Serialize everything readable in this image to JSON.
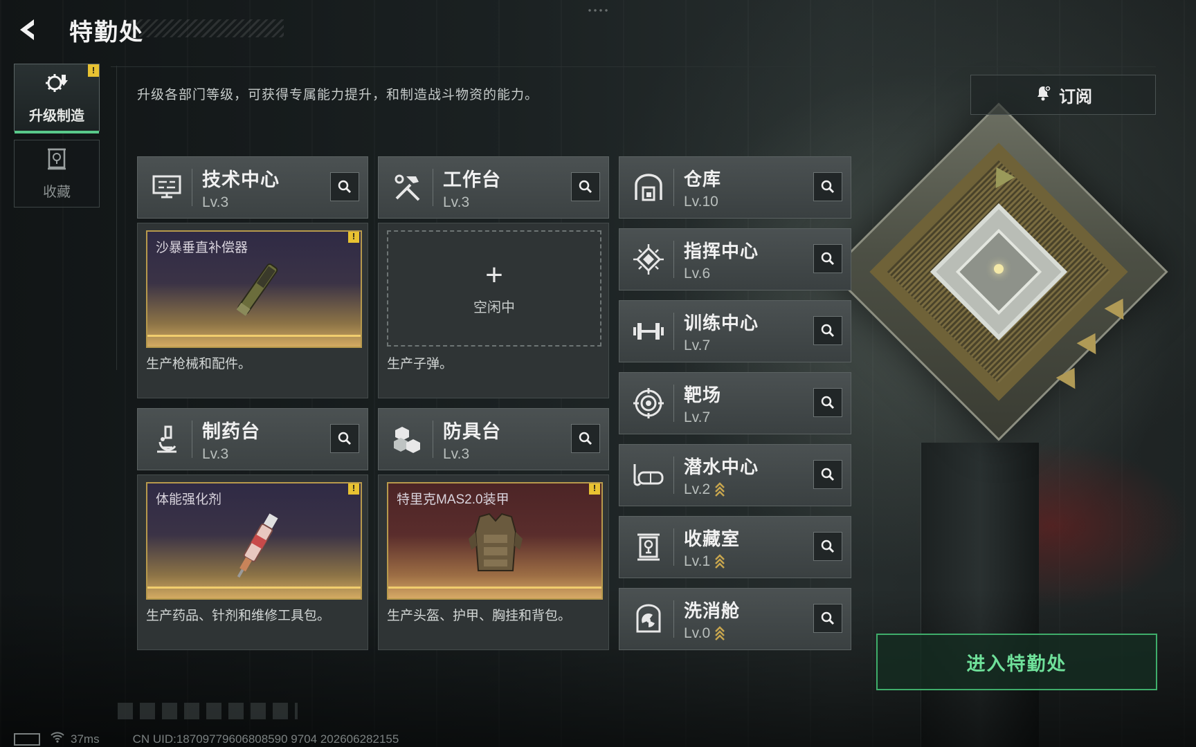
{
  "header": {
    "title": "特勤处"
  },
  "nav": {
    "items": [
      {
        "label": "升级制造",
        "active": true,
        "icon": "upgrade-gear-icon",
        "badge": "!"
      },
      {
        "label": "收藏",
        "active": false,
        "icon": "collection-icon"
      }
    ]
  },
  "intro_text": "升级各部门等级，可获得专属能力提升，和制造战斗物资的能力。",
  "subscribe": {
    "label": "订阅",
    "icon": "bell-icon"
  },
  "stations": [
    {
      "name": "技术中心",
      "level": "Lv.3",
      "icon": "monitor-icon",
      "product": "沙暴垂直补偿器",
      "product_badge": "!",
      "desc": "生产枪械和配件。",
      "theme": "purple"
    },
    {
      "name": "工作台",
      "level": "Lv.3",
      "icon": "tools-icon",
      "idle_text": "空闲中",
      "desc": "生产子弹。"
    },
    {
      "name": "制药台",
      "level": "Lv.3",
      "icon": "microscope-icon",
      "product": "体能强化剂",
      "product_badge": "!",
      "desc": "生产药品、针剂和维修工具包。",
      "theme": "purple"
    },
    {
      "name": "防具台",
      "level": "Lv.3",
      "icon": "cubes-icon",
      "product": "特里克MAS2.0装甲",
      "product_badge": "!",
      "desc": "生产头盔、护甲、胸挂和背包。",
      "theme": "red"
    }
  ],
  "departments": [
    {
      "name": "仓库",
      "level": "Lv.10",
      "icon": "warehouse-icon",
      "upgradable": false
    },
    {
      "name": "指挥中心",
      "level": "Lv.6",
      "icon": "command-chip-icon",
      "upgradable": false
    },
    {
      "name": "训练中心",
      "level": "Lv.7",
      "icon": "dumbbell-icon",
      "upgradable": false
    },
    {
      "name": "靶场",
      "level": "Lv.7",
      "icon": "target-icon",
      "upgradable": false
    },
    {
      "name": "潜水中心",
      "level": "Lv.2",
      "icon": "diving-mask-icon",
      "upgradable": true
    },
    {
      "name": "收藏室",
      "level": "Lv.1",
      "icon": "collection-room-icon",
      "upgradable": true
    },
    {
      "name": "洗消舱",
      "level": "Lv.0",
      "icon": "radiation-icon",
      "upgradable": true
    }
  ],
  "enter_button": "进入特勤处",
  "status_bar": {
    "ping": "37ms",
    "uid": "CN UID:18709779606808590 9704 202606282155"
  },
  "colors": {
    "accent_green": "#3fae6b",
    "warning_yellow": "#e8c232",
    "gold_line": "#f1cd6e"
  }
}
